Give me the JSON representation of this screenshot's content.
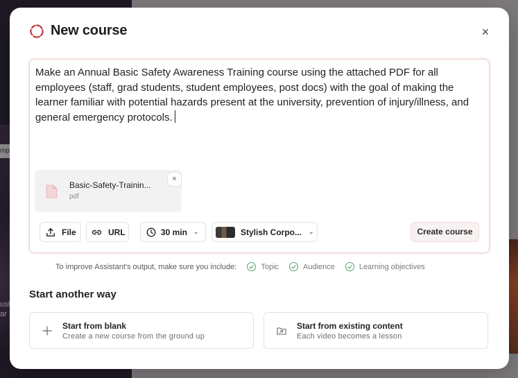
{
  "background": {
    "left_chip_text": "mpt",
    "left_text_lines": [
      "ust",
      "ar"
    ]
  },
  "modal": {
    "title": "New course",
    "close_label": "×"
  },
  "composer": {
    "prompt": "Make an Annual Basic Safety Awareness Training course using the attached PDF for all employees (staff, grad students, student employees, post docs) with the goal of making the learner familiar with potential hazards present at the university, prevention of injury/illness, and general emergency protocols.",
    "attachment": {
      "name": "Basic-Safety-Trainin...",
      "type": "pdf",
      "remove_label": "×"
    },
    "toolbar": {
      "file_label": "File",
      "url_label": "URL",
      "duration_label": "30 min",
      "style_label": "Stylish Corpo..."
    },
    "create_label": "Create course"
  },
  "hints": {
    "intro": "To improve Assistant's output, make sure you include:",
    "items": [
      "Topic",
      "Audience",
      "Learning objectives"
    ]
  },
  "another_way": {
    "title": "Start another way",
    "cards": [
      {
        "title": "Start from blank",
        "subtitle": "Create a new course from the ground up",
        "icon": "plus-icon"
      },
      {
        "title": "Start from existing content",
        "subtitle": "Each video becomes a lesson",
        "icon": "import-icon"
      }
    ]
  },
  "colors": {
    "accent": "#c0393b",
    "check_green": "#5aa06c",
    "composer_border": "#f1cfcf"
  }
}
